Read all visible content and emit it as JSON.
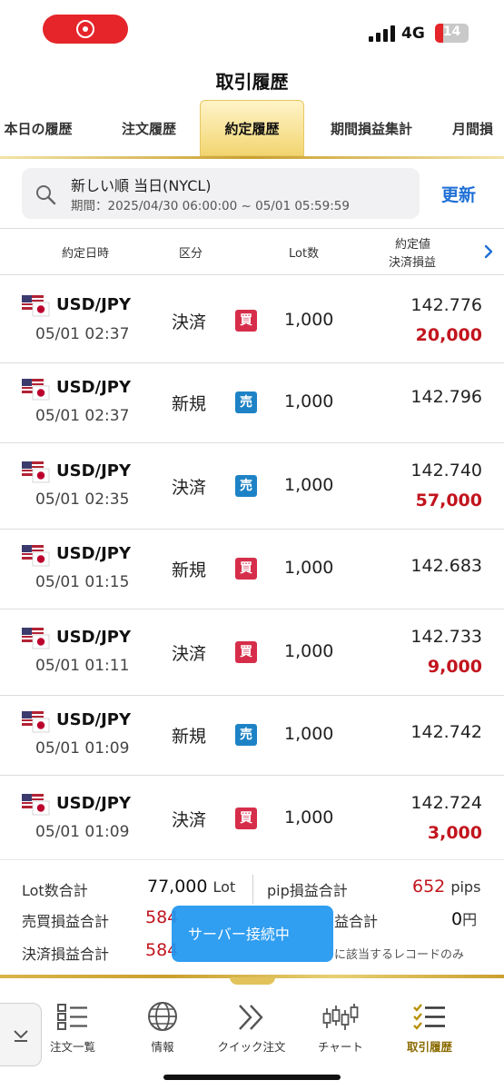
{
  "status_bar": {
    "network": "4G",
    "battery": "14"
  },
  "header": {
    "title": "取引履歴"
  },
  "tabs": [
    {
      "label": "本日の履歴"
    },
    {
      "label": "注文履歴"
    },
    {
      "label": "約定履歴",
      "active": true
    },
    {
      "label": "期間損益集計"
    },
    {
      "label": "月間損"
    }
  ],
  "filter": {
    "title": "新しい順 当日(NYCL)",
    "period": "期間：2025/04/30 06:00:00 ~ 05/01 05:59:59",
    "refresh_label": "更新"
  },
  "table": {
    "headers": {
      "datetime": "約定日時",
      "type": "区分",
      "lot": "Lot数",
      "price": "約定値",
      "pl": "決済損益"
    },
    "rows": [
      {
        "pair": "USD/JPY",
        "time": "05/01 02:37",
        "kind": "決済",
        "side": "買",
        "side_type": "buy",
        "lot": "1,000",
        "price": "142.776",
        "pl": "20,000"
      },
      {
        "pair": "USD/JPY",
        "time": "05/01 02:37",
        "kind": "新規",
        "side": "売",
        "side_type": "sell",
        "lot": "1,000",
        "price": "142.796",
        "pl": ""
      },
      {
        "pair": "USD/JPY",
        "time": "05/01 02:35",
        "kind": "決済",
        "side": "売",
        "side_type": "sell",
        "lot": "1,000",
        "price": "142.740",
        "pl": "57,000"
      },
      {
        "pair": "USD/JPY",
        "time": "05/01 01:15",
        "kind": "新規",
        "side": "買",
        "side_type": "buy",
        "lot": "1,000",
        "price": "142.683",
        "pl": ""
      },
      {
        "pair": "USD/JPY",
        "time": "05/01 01:11",
        "kind": "決済",
        "side": "買",
        "side_type": "buy",
        "lot": "1,000",
        "price": "142.733",
        "pl": "9,000"
      },
      {
        "pair": "USD/JPY",
        "time": "05/01 01:09",
        "kind": "新規",
        "side": "売",
        "side_type": "sell",
        "lot": "1,000",
        "price": "142.742",
        "pl": ""
      },
      {
        "pair": "USD/JPY",
        "time": "05/01 01:09",
        "kind": "決済",
        "side": "買",
        "side_type": "buy",
        "lot": "1,000",
        "price": "142.724",
        "pl": "3,000"
      }
    ]
  },
  "summary": {
    "lot_total_label": "Lot数合計",
    "lot_total_value": "77,000",
    "lot_total_unit": "Lot",
    "pip_total_label": "pip損益合計",
    "pip_total_value": "652",
    "pip_total_unit": "pips",
    "trade_pl_label": "売買損益合計",
    "trade_pl_value": "584",
    "swap_label": "益合計",
    "swap_value": "0",
    "swap_unit": "円",
    "settle_pl_label": "決済損益合計",
    "settle_pl_value": "584",
    "note": "に該当するレコードのみ"
  },
  "toast": {
    "text": "サーバー接続中"
  },
  "bottom_nav": [
    {
      "label": "注文一覧",
      "icon": "list-icon"
    },
    {
      "label": "情報",
      "icon": "globe-icon"
    },
    {
      "label": "クイック注文",
      "icon": "chevrons-right-icon"
    },
    {
      "label": "チャート",
      "icon": "candlestick-icon"
    },
    {
      "label": "取引履歴",
      "icon": "checklist-icon",
      "active": true
    }
  ],
  "colors": {
    "accent": "#1e6fd6",
    "profit": "#c2151e",
    "buy": "#d62e4a",
    "sell": "#1e83c6",
    "gold": "#c9a030"
  }
}
